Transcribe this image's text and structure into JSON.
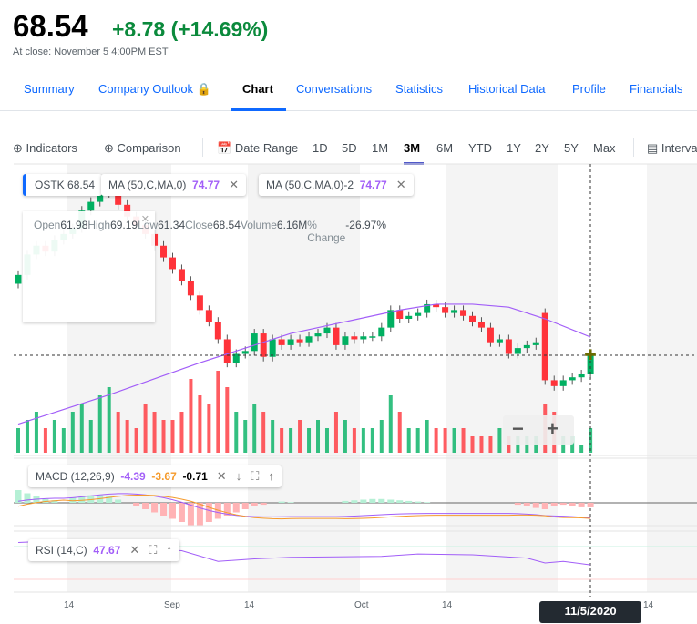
{
  "quote": {
    "price": "68.54",
    "change": "+8.78 (+14.69%)",
    "close_text": "At close: November 5 4:00PM EST"
  },
  "tabs": [
    {
      "label": "Summary"
    },
    {
      "label": "Company Outlook"
    },
    {
      "label": "Chart",
      "active": true
    },
    {
      "label": "Conversations"
    },
    {
      "label": "Statistics"
    },
    {
      "label": "Historical Data"
    },
    {
      "label": "Profile"
    },
    {
      "label": "Financials"
    }
  ],
  "toolbar": {
    "indicators": "Indicators",
    "comparison": "Comparison",
    "date_range": "Date Range",
    "ranges": [
      "1D",
      "5D",
      "1M",
      "3M",
      "6M",
      "YTD",
      "1Y",
      "2Y",
      "5Y",
      "Max"
    ],
    "active_range": "3M",
    "interval": "Interval"
  },
  "legend": {
    "symbol": "OSTK",
    "symbol_value": "68.54",
    "ma1": "MA (50,C,MA,0)",
    "ma1_value": "74.77",
    "ma2": "MA (50,C,MA,0)-2",
    "ma2_value": "74.77"
  },
  "tooltip": {
    "rows": [
      [
        "Open",
        "61.98"
      ],
      [
        "High",
        "69.19"
      ],
      [
        "Low",
        "61.34"
      ],
      [
        "Close",
        "68.54"
      ],
      [
        "Volume",
        "6.16M"
      ],
      [
        "% Change",
        "-26.97%"
      ]
    ]
  },
  "macd": {
    "label": "MACD (12,26,9)",
    "v1": "-4.39",
    "v2": "-3.67",
    "v3": "-0.71"
  },
  "rsi": {
    "label": "RSI (14,C)",
    "value": "47.67"
  },
  "xaxis": [
    "14",
    "Sep",
    "14",
    "Oct",
    "14",
    "14"
  ],
  "crosshair_date": "11/5/2020",
  "colors": {
    "up": "#00b061",
    "down": "#ff333a",
    "ma": "#a25ef8",
    "signal": "#f59a2b",
    "accent": "#0f69ff"
  },
  "chart_data": {
    "type": "candlestick",
    "closes": [
      96,
      103,
      106,
      104,
      108,
      110,
      112,
      118,
      121,
      124,
      127,
      120,
      116,
      113,
      110,
      106,
      102,
      98,
      94,
      89,
      84,
      80,
      74,
      66,
      69,
      70,
      76,
      68,
      74,
      72,
      74,
      73,
      75,
      76,
      78,
      72,
      75,
      74,
      75,
      75,
      78,
      84,
      81,
      82,
      83,
      86,
      85,
      83,
      84,
      82,
      80,
      78,
      73,
      74,
      69,
      71,
      72,
      73,
      60,
      58,
      60,
      61,
      62,
      68.54
    ],
    "volume_m": [
      3,
      4,
      5,
      3,
      4,
      3,
      5,
      6,
      4,
      7,
      8,
      5,
      4,
      3,
      6,
      5,
      4,
      4,
      5,
      9,
      7,
      6,
      10,
      8,
      5,
      4,
      6,
      5,
      4,
      3,
      3,
      4,
      3,
      4,
      3,
      5,
      4,
      3,
      3,
      3,
      4,
      7,
      5,
      3,
      3,
      4,
      3,
      3,
      3,
      3,
      2,
      2,
      2,
      3,
      2,
      2,
      2,
      2,
      6,
      5,
      2,
      2,
      1,
      3
    ],
    "ma": [
      [
        0,
        45
      ],
      [
        10,
        55
      ],
      [
        20,
        66
      ],
      [
        24,
        70
      ],
      [
        30,
        76
      ],
      [
        36,
        80
      ],
      [
        42,
        84
      ],
      [
        46,
        86
      ],
      [
        50,
        86
      ],
      [
        54,
        85
      ],
      [
        58,
        81
      ],
      [
        63,
        74.77
      ]
    ],
    "macd_hist": [
      2,
      1.5,
      1,
      0.6,
      0.4,
      0,
      0.8,
      1,
      1.2,
      1.2,
      1,
      0.5,
      0,
      -0.5,
      -1,
      -1.5,
      -2,
      -2.5,
      -3,
      -3.5,
      -3.5,
      -3,
      -2.5,
      -2,
      -1.5,
      -1,
      -0.5,
      -0.3,
      0,
      0.2,
      0.1,
      0,
      0,
      0,
      0,
      0,
      0.3,
      0.4,
      0.5,
      0.6,
      0.6,
      0.5,
      0.4,
      0.3,
      0.2,
      0.1,
      0,
      0,
      0,
      0,
      0,
      0,
      0,
      0,
      0,
      -0.3,
      -0.5,
      -0.8,
      -1,
      -0.5,
      -0.3,
      -0.5,
      -0.7,
      -0.71
    ],
    "rsi_values": [
      [
        0,
        75
      ],
      [
        2,
        76
      ],
      [
        18,
        65
      ],
      [
        22,
        52
      ],
      [
        26,
        55
      ],
      [
        30,
        57
      ],
      [
        40,
        58
      ],
      [
        44,
        61
      ],
      [
        50,
        60
      ],
      [
        56,
        56
      ],
      [
        58,
        50
      ],
      [
        60,
        52
      ],
      [
        63,
        47.67
      ]
    ]
  }
}
